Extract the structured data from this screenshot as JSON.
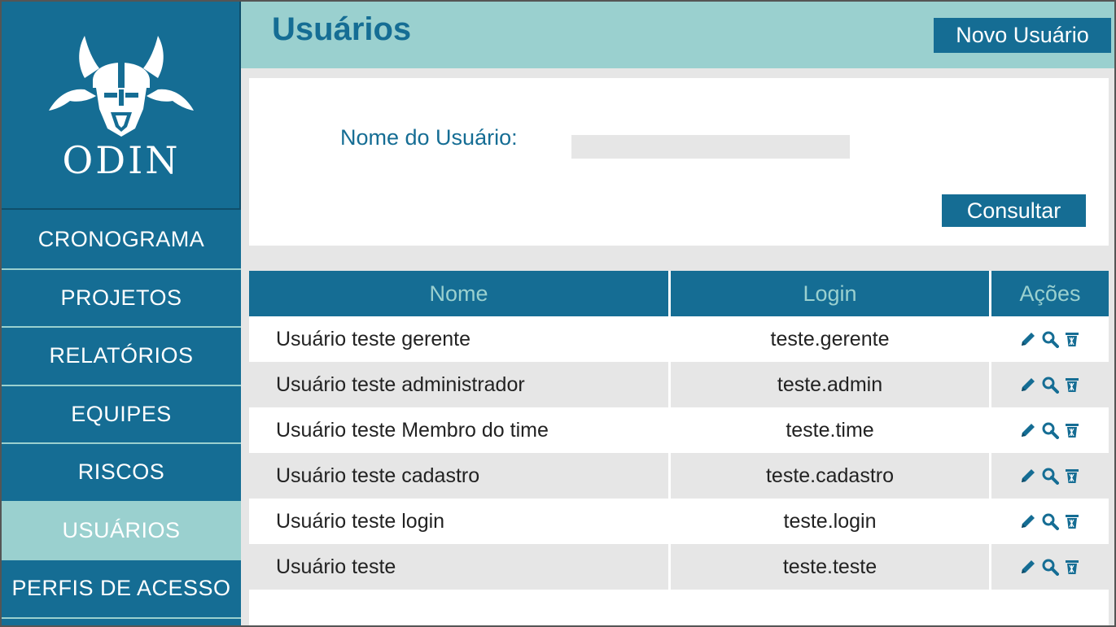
{
  "app": {
    "logo_text": "ODIN"
  },
  "sidebar": {
    "items": [
      {
        "label": "CRONOGRAMA",
        "active": false
      },
      {
        "label": "PROJETOS",
        "active": false
      },
      {
        "label": "RELATÓRIOS",
        "active": false
      },
      {
        "label": "EQUIPES",
        "active": false
      },
      {
        "label": "RISCOS",
        "active": false
      },
      {
        "label": "USUÁRIOS",
        "active": true
      },
      {
        "label": "PERFIS DE ACESSO",
        "active": false
      }
    ]
  },
  "header": {
    "title": "Usuários",
    "new_user_label": "Novo Usuário"
  },
  "filter": {
    "label": "Nome do Usuário:",
    "value": "",
    "placeholder": "",
    "submit_label": "Consultar"
  },
  "table": {
    "headers": {
      "name": "Nome",
      "login": "Login",
      "actions": "Ações"
    },
    "rows": [
      {
        "name": "Usuário teste gerente",
        "login": "teste.gerente"
      },
      {
        "name": "Usuário teste administrador",
        "login": "teste.admin"
      },
      {
        "name": "Usuário teste Membro do time",
        "login": "teste.time"
      },
      {
        "name": "Usuário teste cadastro",
        "login": "teste.cadastro"
      },
      {
        "name": "Usuário teste login",
        "login": "teste.login"
      },
      {
        "name": "Usuário teste",
        "login": "teste.teste"
      }
    ],
    "row_actions": [
      "pencil-icon",
      "magnifier-icon",
      "trash-icon"
    ]
  },
  "colors": {
    "primary": "#156d94",
    "accent": "#9ad0cf",
    "stripe": "#e6e6e6"
  }
}
